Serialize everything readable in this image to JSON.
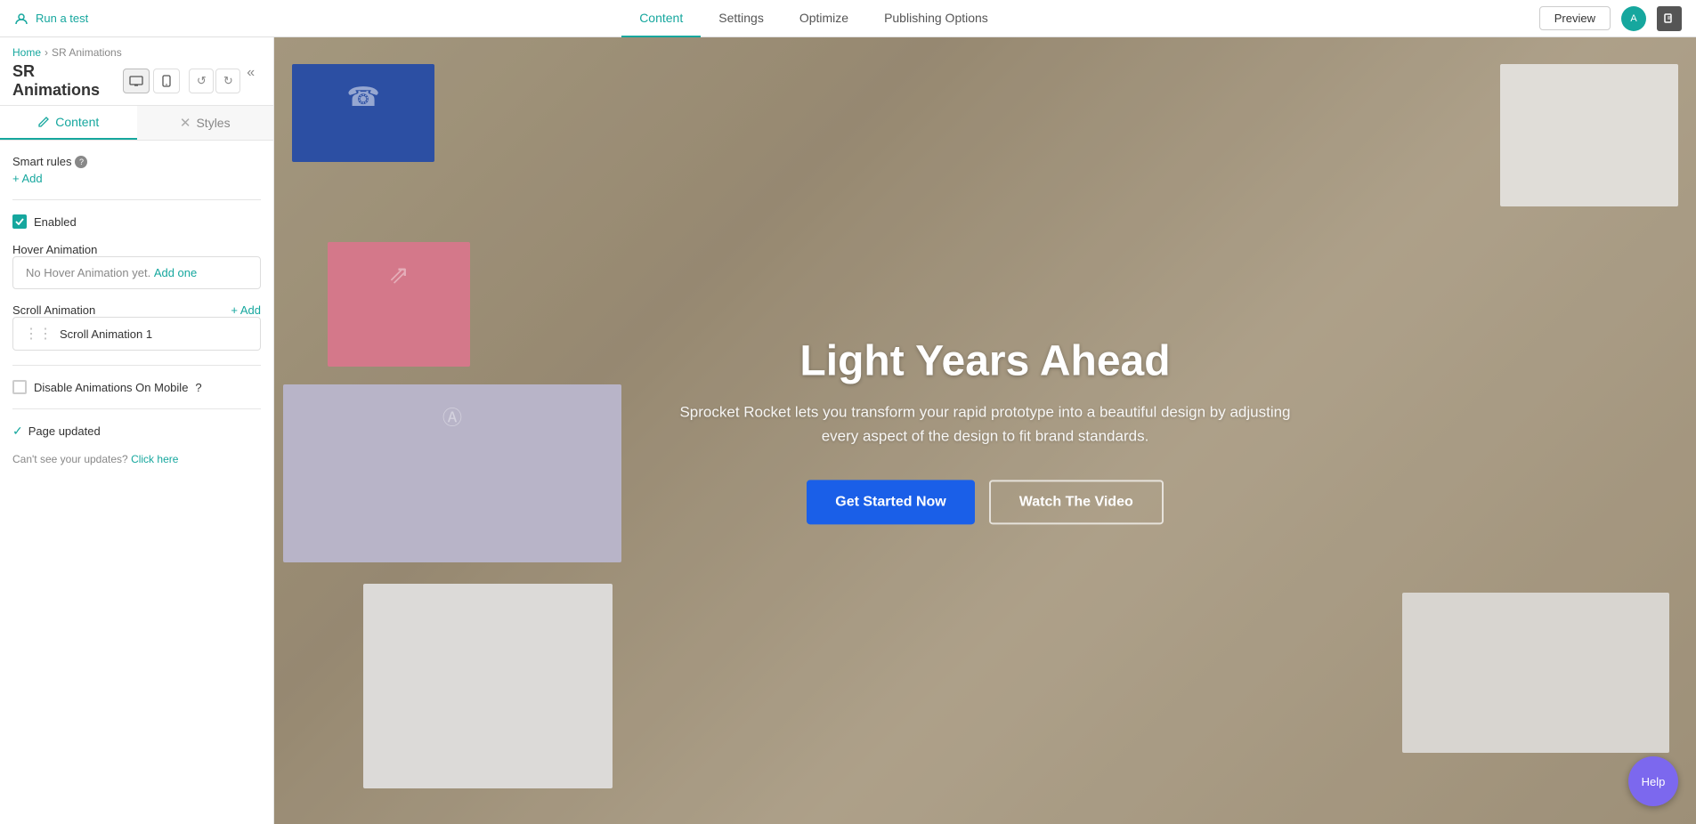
{
  "topnav": {
    "run_test_label": "Run a test",
    "tabs": [
      {
        "id": "content",
        "label": "Content",
        "active": true
      },
      {
        "id": "settings",
        "label": "Settings",
        "active": false
      },
      {
        "id": "optimize",
        "label": "Optimize",
        "active": false
      },
      {
        "id": "publishing-options",
        "label": "Publishing Options",
        "active": false
      }
    ],
    "preview_label": "Preview"
  },
  "sidebar": {
    "breadcrumb_home": "Home",
    "breadcrumb_page": "SR Animations",
    "page_title": "SR Animations",
    "content_tab": "Content",
    "styles_tab": "Styles",
    "smart_rules_label": "Smart rules",
    "add_label": "+ Add",
    "enabled_label": "Enabled",
    "hover_animation_label": "Hover Animation",
    "hover_animation_placeholder": "No Hover Animation yet.",
    "hover_animation_add": "Add one",
    "scroll_animation_label": "Scroll Animation",
    "scroll_animation_add": "+ Add",
    "scroll_animation_item": "Scroll Animation 1",
    "disable_mobile_label": "Disable Animations On Mobile",
    "page_updated_label": "Page updated",
    "cant_see_text": "Can't see your updates?",
    "click_here": "Click here"
  },
  "hero": {
    "title": "Light Years Ahead",
    "subtitle": "Sprocket Rocket lets you transform your rapid prototype into a beautiful design by adjusting every aspect of the design to fit brand standards.",
    "cta_primary": "Get Started Now",
    "cta_secondary": "Watch The Video"
  },
  "help": {
    "label": "Help"
  }
}
